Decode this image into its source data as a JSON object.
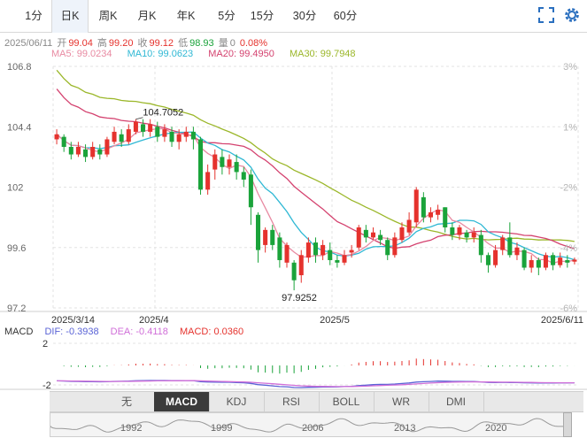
{
  "tabs": [
    {
      "label": "1分"
    },
    {
      "label": "日K"
    },
    {
      "label": "周K"
    },
    {
      "label": "月K"
    },
    {
      "label": "年K"
    },
    {
      "label": "5分"
    },
    {
      "label": "15分"
    },
    {
      "label": "30分"
    },
    {
      "label": "60分"
    }
  ],
  "active_tab": "日K",
  "info": {
    "date": "2025/06/11",
    "open_label": "开",
    "open": "99.04",
    "high_label": "高",
    "high": "99.20",
    "close_label": "收",
    "close": "99.12",
    "low_label": "低",
    "low": "98.93",
    "vol_label": "量",
    "vol": "0",
    "change": "0.08%"
  },
  "ma": {
    "ma5": "MA5: 99.0234",
    "ma10": "MA10: 99.0623",
    "ma20": "MA20: 99.4950",
    "ma30": "MA30: 99.7948"
  },
  "colors": {
    "up": "#e5322d",
    "down": "#1aa33a",
    "ma5": "#e88aa2",
    "ma10": "#2fb8d4",
    "ma20": "#d4426f",
    "ma30": "#9bb72a",
    "dif": "#5a63d6",
    "dea": "#d06ed8"
  },
  "chart_data": {
    "type": "candlestick",
    "y_ticks_left": [
      "106.8",
      "104.4",
      "102",
      "99.6",
      "97.2"
    ],
    "y_ticks_right": [
      "3%",
      "1%",
      "-2%",
      "-4%",
      "-6%"
    ],
    "x_ticks": [
      "2025/3/14",
      "2025/4",
      "2025/5",
      "2025/6/11"
    ],
    "ylim": [
      97.2,
      106.8
    ],
    "annotations": {
      "high": "104.7052",
      "low": "97.9252"
    },
    "candles": [
      {
        "o": 103.9,
        "c": 104.1,
        "h": 104.3,
        "l": 103.7
      },
      {
        "o": 104.0,
        "c": 103.6,
        "h": 104.1,
        "l": 103.4
      },
      {
        "o": 103.6,
        "c": 103.3,
        "h": 103.8,
        "l": 103.1
      },
      {
        "o": 103.3,
        "c": 103.6,
        "h": 103.8,
        "l": 103.2
      },
      {
        "o": 103.5,
        "c": 103.2,
        "h": 103.7,
        "l": 103.0
      },
      {
        "o": 103.2,
        "c": 103.6,
        "h": 103.8,
        "l": 103.1
      },
      {
        "o": 103.5,
        "c": 103.3,
        "h": 103.7,
        "l": 103.1
      },
      {
        "o": 103.3,
        "c": 103.9,
        "h": 104.0,
        "l": 103.2
      },
      {
        "o": 103.8,
        "c": 104.2,
        "h": 104.4,
        "l": 103.7
      },
      {
        "o": 104.1,
        "c": 103.8,
        "h": 104.3,
        "l": 103.6
      },
      {
        "o": 103.8,
        "c": 104.3,
        "h": 104.5,
        "l": 103.7
      },
      {
        "o": 104.2,
        "c": 104.6,
        "h": 104.7,
        "l": 104.1
      },
      {
        "o": 104.5,
        "c": 104.2,
        "h": 104.7,
        "l": 104.0
      },
      {
        "o": 104.2,
        "c": 104.5,
        "h": 104.7,
        "l": 104.0
      },
      {
        "o": 104.4,
        "c": 104.0,
        "h": 104.6,
        "l": 103.8
      },
      {
        "o": 104.0,
        "c": 104.3,
        "h": 104.5,
        "l": 103.8
      },
      {
        "o": 104.2,
        "c": 103.8,
        "h": 104.4,
        "l": 103.6
      },
      {
        "o": 103.8,
        "c": 104.1,
        "h": 104.3,
        "l": 103.5
      },
      {
        "o": 104.0,
        "c": 104.2,
        "h": 104.4,
        "l": 103.8
      },
      {
        "o": 104.2,
        "c": 103.9,
        "h": 104.4,
        "l": 103.5
      },
      {
        "o": 103.9,
        "c": 101.9,
        "h": 104.0,
        "l": 101.7
      },
      {
        "o": 101.9,
        "c": 102.6,
        "h": 102.9,
        "l": 101.7
      },
      {
        "o": 102.7,
        "c": 103.3,
        "h": 103.5,
        "l": 102.3
      },
      {
        "o": 103.2,
        "c": 102.8,
        "h": 103.5,
        "l": 102.5
      },
      {
        "o": 102.8,
        "c": 103.1,
        "h": 103.3,
        "l": 102.5
      },
      {
        "o": 103.0,
        "c": 102.6,
        "h": 103.3,
        "l": 102.3
      },
      {
        "o": 102.6,
        "c": 102.3,
        "h": 102.8,
        "l": 102.0
      },
      {
        "o": 102.5,
        "c": 101.2,
        "h": 102.7,
        "l": 100.5
      },
      {
        "o": 100.9,
        "c": 99.5,
        "h": 101.0,
        "l": 99.0
      },
      {
        "o": 99.7,
        "c": 100.3,
        "h": 100.4,
        "l": 99.4
      },
      {
        "o": 100.3,
        "c": 99.7,
        "h": 100.5,
        "l": 99.5
      },
      {
        "o": 100.0,
        "c": 99.1,
        "h": 100.2,
        "l": 98.8
      },
      {
        "o": 99.0,
        "c": 99.7,
        "h": 99.8,
        "l": 98.8
      },
      {
        "o": 99.0,
        "c": 98.3,
        "h": 99.1,
        "l": 97.9
      },
      {
        "o": 98.5,
        "c": 99.3,
        "h": 99.5,
        "l": 98.2
      },
      {
        "o": 99.2,
        "c": 99.8,
        "h": 100.0,
        "l": 99.0
      },
      {
        "o": 99.8,
        "c": 99.3,
        "h": 100.0,
        "l": 99.0
      },
      {
        "o": 99.3,
        "c": 99.7,
        "h": 99.9,
        "l": 99.1
      },
      {
        "o": 99.5,
        "c": 99.1,
        "h": 99.8,
        "l": 98.9
      },
      {
        "o": 99.1,
        "c": 99.0,
        "h": 99.3,
        "l": 98.8
      },
      {
        "o": 99.0,
        "c": 99.3,
        "h": 99.5,
        "l": 98.9
      },
      {
        "o": 99.4,
        "c": 99.5,
        "h": 99.7,
        "l": 99.2
      },
      {
        "o": 99.6,
        "c": 100.4,
        "h": 100.5,
        "l": 99.5
      },
      {
        "o": 100.3,
        "c": 100.0,
        "h": 100.5,
        "l": 99.8
      },
      {
        "o": 100.0,
        "c": 100.2,
        "h": 100.4,
        "l": 99.9
      },
      {
        "o": 100.1,
        "c": 99.9,
        "h": 100.3,
        "l": 99.7
      },
      {
        "o": 99.9,
        "c": 99.3,
        "h": 100.0,
        "l": 99.1
      },
      {
        "o": 99.3,
        "c": 100.0,
        "h": 100.2,
        "l": 99.2
      },
      {
        "o": 99.9,
        "c": 100.4,
        "h": 100.6,
        "l": 99.8
      },
      {
        "o": 100.2,
        "c": 100.7,
        "h": 101.0,
        "l": 100.1
      },
      {
        "o": 100.6,
        "c": 101.9,
        "h": 102.0,
        "l": 100.4
      },
      {
        "o": 101.6,
        "c": 100.8,
        "h": 101.8,
        "l": 100.6
      },
      {
        "o": 100.8,
        "c": 101.0,
        "h": 101.2,
        "l": 100.6
      },
      {
        "o": 100.9,
        "c": 101.1,
        "h": 101.3,
        "l": 100.7
      },
      {
        "o": 101.2,
        "c": 100.4,
        "h": 101.2,
        "l": 100.2
      },
      {
        "o": 100.4,
        "c": 100.1,
        "h": 100.6,
        "l": 99.9
      },
      {
        "o": 100.1,
        "c": 100.4,
        "h": 100.5,
        "l": 99.9
      },
      {
        "o": 100.2,
        "c": 100.0,
        "h": 100.3,
        "l": 99.8
      },
      {
        "o": 100.0,
        "c": 100.2,
        "h": 100.4,
        "l": 99.8
      },
      {
        "o": 100.1,
        "c": 99.3,
        "h": 100.3,
        "l": 99.0
      },
      {
        "o": 99.3,
        "c": 98.9,
        "h": 99.4,
        "l": 98.6
      },
      {
        "o": 98.9,
        "c": 99.5,
        "h": 99.7,
        "l": 98.8
      },
      {
        "o": 99.5,
        "c": 100.0,
        "h": 100.1,
        "l": 99.3
      },
      {
        "o": 100.0,
        "c": 99.3,
        "h": 100.6,
        "l": 99.2
      },
      {
        "o": 99.3,
        "c": 99.6,
        "h": 99.8,
        "l": 99.1
      },
      {
        "o": 99.5,
        "c": 98.8,
        "h": 99.6,
        "l": 98.7
      },
      {
        "o": 98.8,
        "c": 99.1,
        "h": 99.3,
        "l": 98.6
      },
      {
        "o": 99.1,
        "c": 98.8,
        "h": 99.2,
        "l": 98.5
      },
      {
        "o": 98.8,
        "c": 99.3,
        "h": 99.4,
        "l": 98.7
      },
      {
        "o": 99.3,
        "c": 98.9,
        "h": 99.4,
        "l": 98.7
      },
      {
        "o": 98.9,
        "c": 99.2,
        "h": 99.4,
        "l": 98.8
      },
      {
        "o": 99.1,
        "c": 99.0,
        "h": 99.3,
        "l": 98.8
      },
      {
        "o": 99.04,
        "c": 99.12,
        "h": 99.2,
        "l": 98.93
      }
    ]
  },
  "macd": {
    "label": "MACD",
    "dif": "DIF: -0.3938",
    "dea": "DEA: -0.4118",
    "macd": "MACD: 0.0360",
    "y_ticks": [
      "2",
      "-2"
    ]
  },
  "indicator_buttons": [
    {
      "label": "无"
    },
    {
      "label": "MACD"
    },
    {
      "label": "KDJ"
    },
    {
      "label": "RSI"
    },
    {
      "label": "BOLL"
    },
    {
      "label": "WR"
    },
    {
      "label": "DMI"
    }
  ],
  "active_indicator": "MACD",
  "navigator": {
    "years": [
      "1992",
      "1999",
      "2006",
      "2013",
      "2020"
    ]
  }
}
